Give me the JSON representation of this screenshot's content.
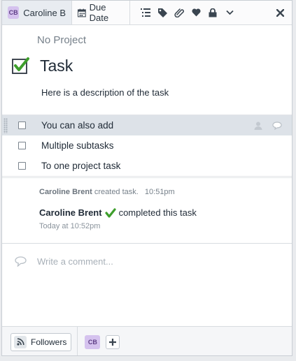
{
  "toolbar": {
    "assignee_initials": "CB",
    "assignee_name": "Caroline B",
    "due_date_label": "Due Date",
    "icons": [
      "subtasks-icon",
      "tag-icon",
      "attachment-icon",
      "heart-icon",
      "lock-icon",
      "chevron-down-icon"
    ],
    "close_icon": "close-icon"
  },
  "task": {
    "project": "No Project",
    "title": "Task",
    "description": "Here is a description of the task",
    "completed": true
  },
  "subtasks": [
    {
      "label": "You can also add",
      "highlighted": true
    },
    {
      "label": "Multiple subtasks",
      "highlighted": false
    },
    {
      "label": "To one project task",
      "highlighted": false
    }
  ],
  "activity": {
    "created_by": "Caroline Brent",
    "created_text": "created task.",
    "created_time": "10:51pm",
    "completed_by": "Caroline Brent",
    "completed_text": "completed this task",
    "completed_time": "Today at 10:52pm"
  },
  "comment": {
    "placeholder": "Write a comment..."
  },
  "footer": {
    "followers_label": "Followers",
    "follower_initials": "CB"
  },
  "colors": {
    "avatar_bg": "#d5c2ee",
    "check_green": "#3e9e2c",
    "highlight_row": "#dde2e8"
  }
}
